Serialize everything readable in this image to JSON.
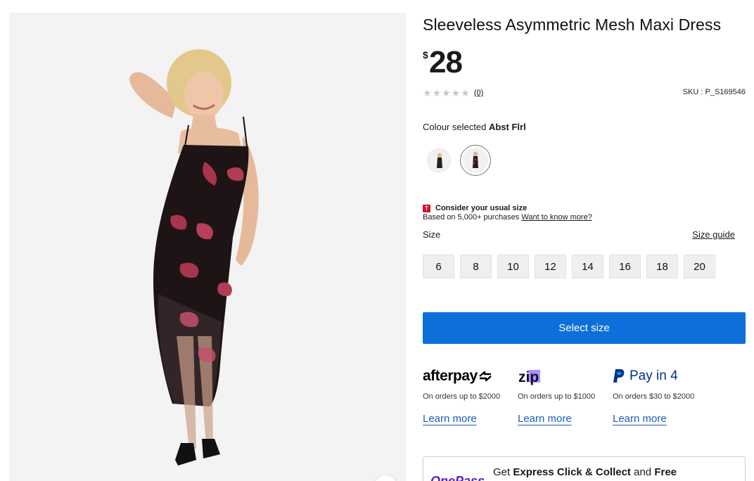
{
  "product": {
    "title": "Sleeveless Asymmetric Mesh Maxi Dress",
    "price_currency": "$",
    "price_amount": "28",
    "rating_stars": 0,
    "review_count": "(0)",
    "sku": "SKU : P_S169546"
  },
  "colour": {
    "label": "Colour selected",
    "selected": "Abst Flrl"
  },
  "fit": {
    "badge": "T",
    "title": "Consider your usual size",
    "subtitle": "Based on 5,000+ purchases",
    "link": "Want to know more?"
  },
  "size": {
    "label": "Size",
    "guide_link": "Size guide",
    "options": [
      "6",
      "8",
      "10",
      "12",
      "14",
      "16",
      "18",
      "20"
    ]
  },
  "cta": {
    "select_size": "Select size"
  },
  "payments": [
    {
      "brand": "afterpay",
      "desc": "On orders up to $2000",
      "link": "Learn more"
    },
    {
      "brand": "zip",
      "desc": "On orders up to $1000",
      "link": "Learn more"
    },
    {
      "brand": "Pay in 4",
      "desc": "On orders $30 to $2000",
      "link": "Learn more"
    }
  ],
  "promo": {
    "logo": "OnePass",
    "text_prefix": "Get ",
    "text_bold1": "Express Click & Collect",
    "text_mid": " and ",
    "text_bold2": "Free"
  },
  "colors": {
    "primary_blue": "#0d6fd9",
    "link_blue": "#1c5cc2",
    "badge_red": "#d0112b",
    "onepass_purple": "#5a1ec2"
  }
}
